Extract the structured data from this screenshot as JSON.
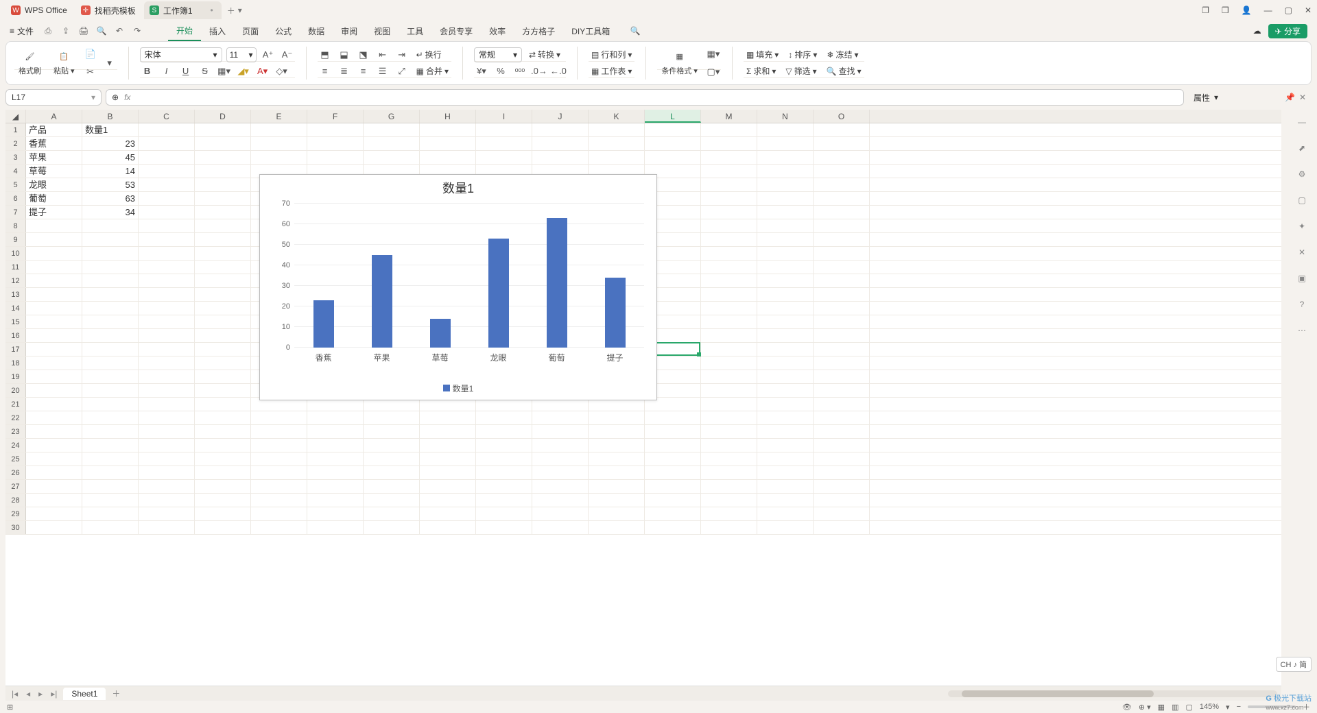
{
  "titlebar": {
    "app": "WPS Office",
    "tab_template": "找稻壳模板",
    "doc": "工作簿1"
  },
  "menu": {
    "file": "文件",
    "items": [
      "开始",
      "插入",
      "页面",
      "公式",
      "数据",
      "审阅",
      "视图",
      "工具",
      "会员专享",
      "效率",
      "方方格子",
      "DIY工具箱"
    ],
    "active": "开始",
    "share": "分享"
  },
  "ribbon": {
    "brush": "格式刷",
    "paste": "粘贴",
    "font": "宋体",
    "size": "11",
    "wrap": "换行",
    "merge": "合并",
    "general": "常规",
    "convert": "转换",
    "rowcol": "行和列",
    "worksheet": "工作表",
    "condfmt": "条件格式",
    "fill": "填充",
    "sort": "排序",
    "freeze": "冻结",
    "sum": "求和",
    "filter": "筛选",
    "find": "查找"
  },
  "namebox": "L17",
  "properties": "属性",
  "columns": [
    "A",
    "B",
    "C",
    "D",
    "E",
    "F",
    "G",
    "H",
    "I",
    "J",
    "K",
    "L",
    "M",
    "N",
    "O"
  ],
  "table": {
    "headers": [
      "产品",
      "数量1"
    ],
    "rows": [
      [
        "香蕉",
        "23"
      ],
      [
        "苹果",
        "45"
      ],
      [
        "草莓",
        "14"
      ],
      [
        "龙眼",
        "53"
      ],
      [
        "葡萄",
        "63"
      ],
      [
        "提子",
        "34"
      ]
    ]
  },
  "chart_data": {
    "type": "bar",
    "title": "数量1",
    "categories": [
      "香蕉",
      "苹果",
      "草莓",
      "龙眼",
      "葡萄",
      "提子"
    ],
    "values": [
      23,
      45,
      14,
      53,
      63,
      34
    ],
    "legend": "数量1",
    "ylim": [
      0,
      70
    ],
    "ystep": 10
  },
  "sheet": "Sheet1",
  "zoom": "145%",
  "ime": "CH ♪ 简",
  "watermark": "极光下载站",
  "watermark_url": "www.xz7.com"
}
